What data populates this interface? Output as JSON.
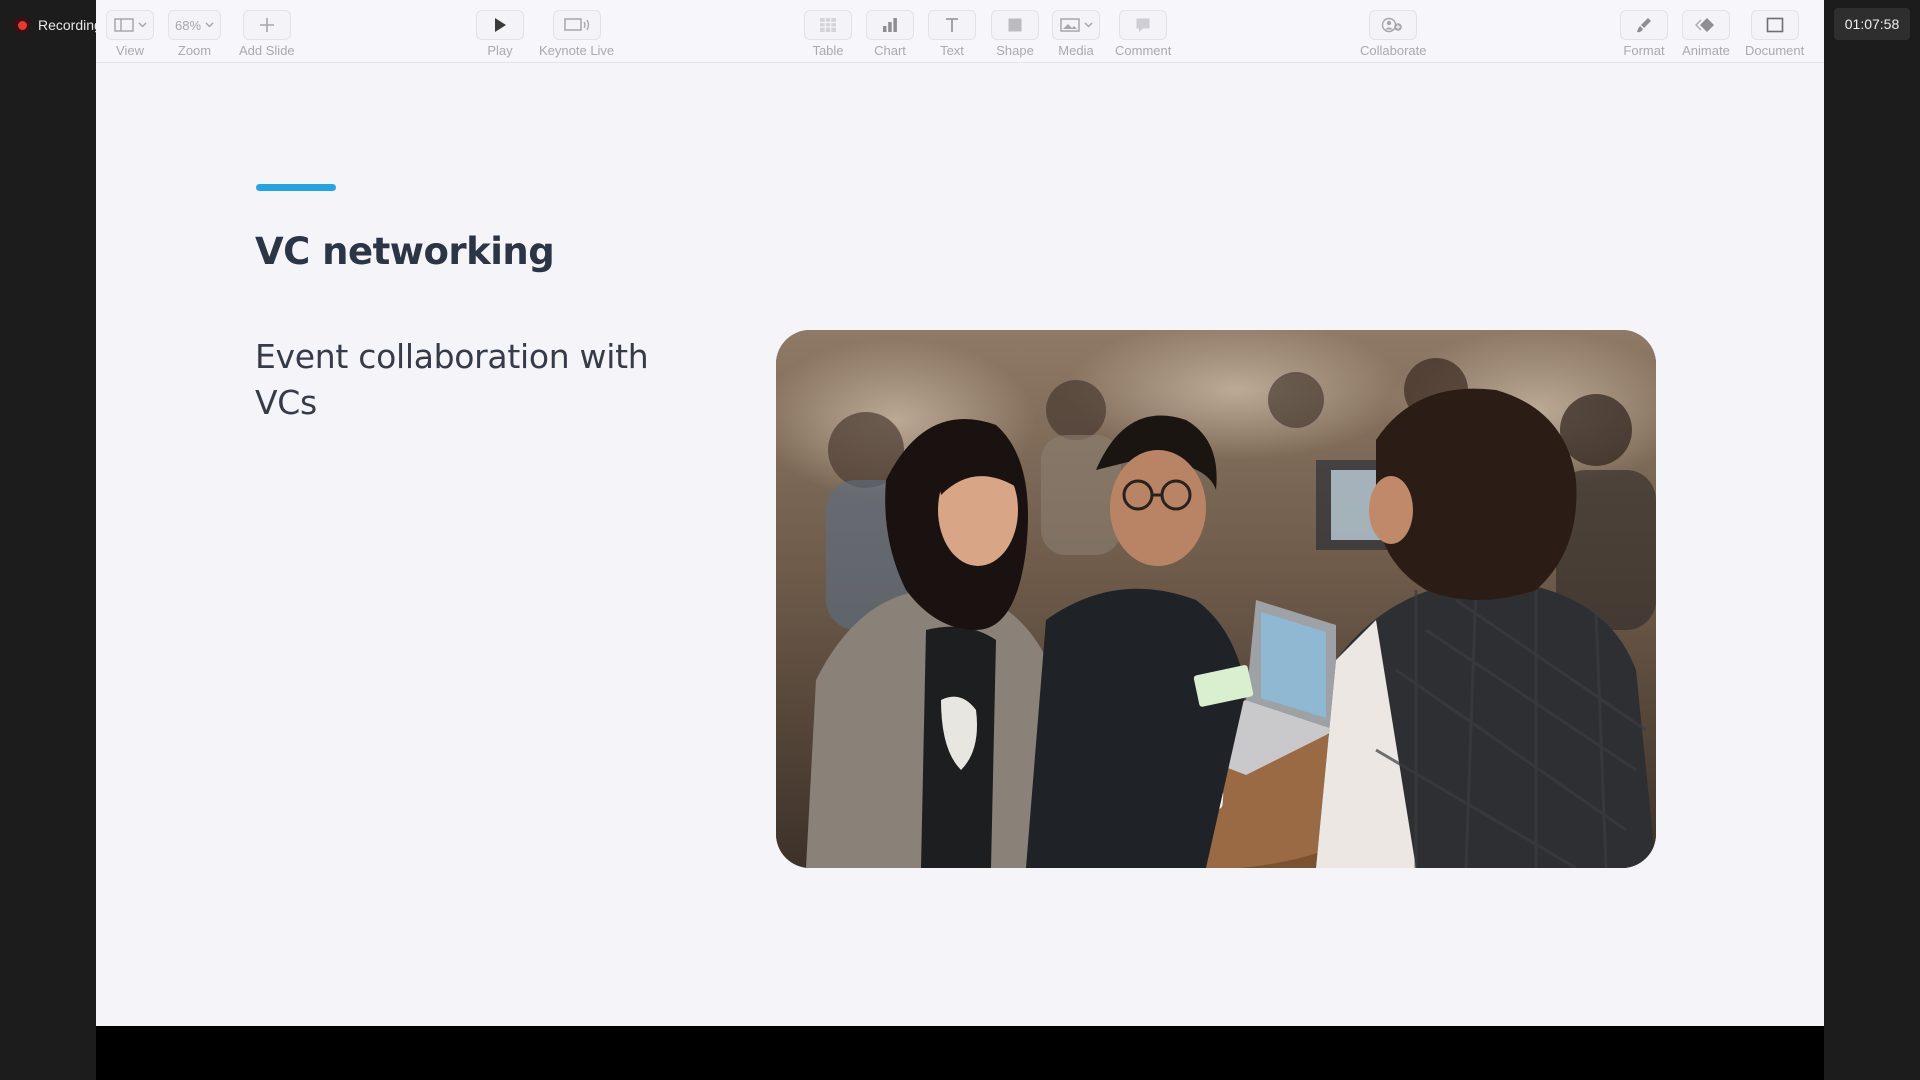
{
  "recording": {
    "label": "Recording"
  },
  "timer": {
    "value": "01:07:58"
  },
  "toolbar": {
    "zoom_value": "68%",
    "items": {
      "view": "View",
      "zoom": "Zoom",
      "add_slide": "Add Slide",
      "play": "Play",
      "keynote_live": "Keynote Live",
      "table": "Table",
      "chart": "Chart",
      "text": "Text",
      "shape": "Shape",
      "media": "Media",
      "comment": "Comment",
      "collaborate": "Collaborate",
      "format": "Format",
      "animate": "Animate",
      "document": "Document"
    }
  },
  "slide": {
    "title": "VC networking",
    "body": "Event collaboration with VCs",
    "accent_color": "#29a3e0"
  }
}
